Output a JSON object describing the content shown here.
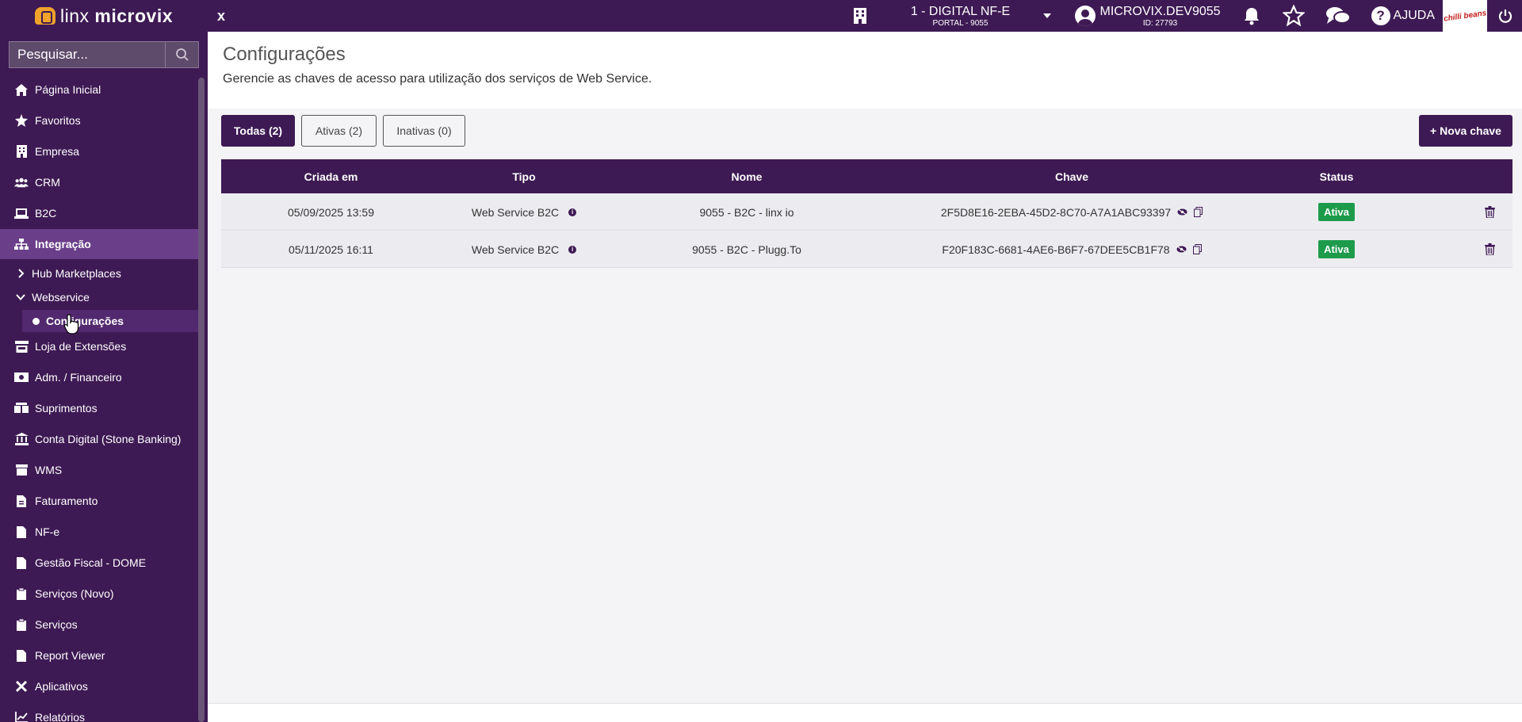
{
  "topbar": {
    "brand_light": "linx ",
    "brand_bold": "microvix",
    "close_label": "x",
    "company_name": "1 - DIGITAL NF-E",
    "company_sub": "PORTAL - 9055",
    "user_name": "MICROVIX.DEV9055",
    "user_id": "ID: 27793",
    "help_label": "AJUDA",
    "brand_thumb_label": "chilli beans"
  },
  "sidebar": {
    "search_placeholder": "Pesquisar...",
    "items": [
      {
        "label": "Página Inicial",
        "icon": "home-icon"
      },
      {
        "label": "Favoritos",
        "icon": "star-icon"
      },
      {
        "label": "Empresa",
        "icon": "building-icon"
      },
      {
        "label": "CRM",
        "icon": "users-icon"
      },
      {
        "label": "B2C",
        "icon": "laptop-icon"
      },
      {
        "label": "Integração",
        "icon": "sitemap-icon"
      },
      {
        "label": "Hub Marketplaces",
        "icon": "chevron-right-icon"
      },
      {
        "label": "Webservice",
        "icon": "chevron-down-icon"
      },
      {
        "label": "Configurações",
        "icon": "dot-icon"
      },
      {
        "label": "Loja de Extensões",
        "icon": "store-icon"
      },
      {
        "label": "Adm. / Financeiro",
        "icon": "money-icon"
      },
      {
        "label": "Suprimentos",
        "icon": "boxes-icon"
      },
      {
        "label": "Conta Digital (Stone Banking)",
        "icon": "bank-icon"
      },
      {
        "label": "WMS",
        "icon": "box-icon"
      },
      {
        "label": "Faturamento",
        "icon": "file-icon"
      },
      {
        "label": "NF-e",
        "icon": "file-icon"
      },
      {
        "label": "Gestão Fiscal - DOME",
        "icon": "file-icon"
      },
      {
        "label": "Serviços (Novo)",
        "icon": "clipboard-icon"
      },
      {
        "label": "Serviços",
        "icon": "clipboard-icon"
      },
      {
        "label": "Report Viewer",
        "icon": "file-icon"
      },
      {
        "label": "Aplicativos",
        "icon": "tools-icon"
      },
      {
        "label": "Relatórios",
        "icon": "chart-line-icon"
      }
    ]
  },
  "page": {
    "title": "Configurações",
    "subtitle": "Gerencie as chaves de acesso para utilização dos serviços de Web Service."
  },
  "filters": {
    "all": "Todas (2)",
    "active": "Ativas (2)",
    "inactive": "Inativas (0)",
    "new_key": "+ Nova chave"
  },
  "table": {
    "headers": [
      "Criada em",
      "Tipo",
      "Nome",
      "Chave",
      "Status"
    ],
    "rows": [
      {
        "created": "05/09/2025 13:59",
        "type": "Web Service B2C",
        "name": "9055 - B2C - linx io",
        "key": "2F5D8E16-2EBA-45D2-8C70-A7A1ABC93397",
        "status": "Ativa"
      },
      {
        "created": "05/11/2025 16:11",
        "type": "Web Service B2C",
        "name": "9055 - B2C - Plugg.To",
        "key": "F20F183C-6681-4AE6-B6F7-67DEE5CB1F78",
        "status": "Ativa"
      }
    ]
  },
  "colors": {
    "primary": "#3e1a54",
    "active_nav": "#6b3e8a",
    "status_green": "#1d9b4b"
  }
}
